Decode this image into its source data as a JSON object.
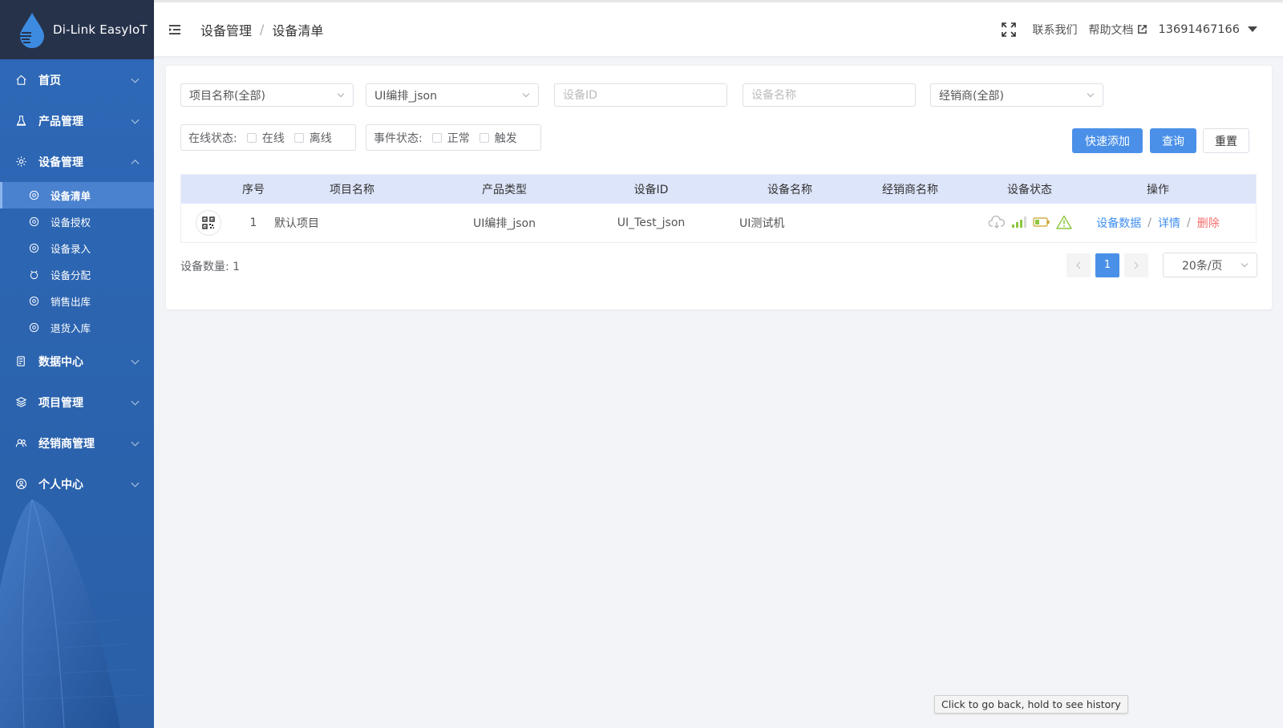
{
  "app": {
    "logo_text": "Di-Link EasyIoT"
  },
  "sidebar": {
    "items": [
      {
        "label": "首页",
        "icon": "home-icon"
      },
      {
        "label": "产品管理",
        "icon": "product-icon"
      },
      {
        "label": "设备管理",
        "icon": "device-icon",
        "expanded": true,
        "children": [
          {
            "label": "设备清单",
            "active": true
          },
          {
            "label": "设备授权"
          },
          {
            "label": "设备录入"
          },
          {
            "label": "设备分配"
          },
          {
            "label": "销售出库"
          },
          {
            "label": "退货入库"
          }
        ]
      },
      {
        "label": "数据中心",
        "icon": "data-center-icon"
      },
      {
        "label": "项目管理",
        "icon": "layers-icon"
      },
      {
        "label": "经销商管理",
        "icon": "dealer-icon"
      },
      {
        "label": "个人中心",
        "icon": "user-circle-icon"
      }
    ]
  },
  "header": {
    "breadcrumb": [
      "设备管理",
      "设备清单"
    ],
    "separator": "/",
    "contact": "联系我们",
    "help": "帮助文档",
    "user": "13691467166"
  },
  "filters": {
    "project_select": "项目名称(全部)",
    "product_select": "UI编排_json",
    "device_id_placeholder": "设备ID",
    "device_name_placeholder": "设备名称",
    "dealer_select": "经销商(全部)",
    "online_label": "在线状态:",
    "online_options": [
      "在线",
      "离线"
    ],
    "event_label": "事件状态:",
    "event_options": [
      "正常",
      "触发"
    ]
  },
  "buttons": {
    "quick_add": "快速添加",
    "query": "查询",
    "reset": "重置"
  },
  "table": {
    "columns": [
      "序号",
      "项目名称",
      "产品类型",
      "设备ID",
      "设备名称",
      "经销商名称",
      "设备状态",
      "操作"
    ],
    "rows": [
      {
        "index": "1",
        "project": "默认项目",
        "product": "UI编排_json",
        "device_id": "UI_Test_json",
        "device_name": "UI测试机",
        "dealer": "",
        "actions": [
          "设备数据",
          "详情",
          "删除"
        ]
      }
    ]
  },
  "footer": {
    "count_label": "设备数量: 1",
    "current_page": "1",
    "page_size": "20条/页"
  },
  "tooltip": "Click to go back, hold to see history",
  "colors": {
    "sidebar": "#2e69b8",
    "primary": "#4a90e8",
    "danger": "#f56c6c",
    "table_header": "#dde5fa"
  }
}
